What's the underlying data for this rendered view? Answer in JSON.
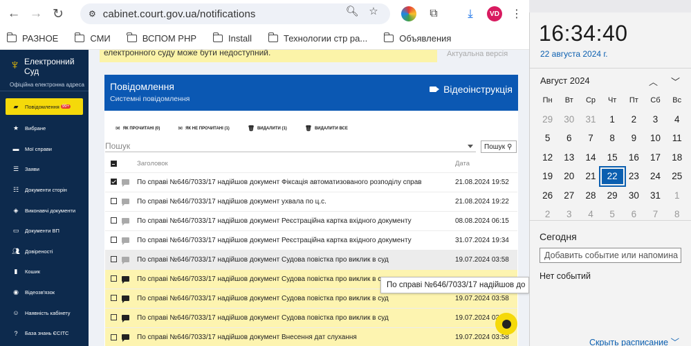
{
  "browser": {
    "url": "cabinet.court.gov.ua/notifications",
    "avatar_initials": "VD",
    "bookmarks": [
      "РАЗНОЕ",
      "СМИ",
      "ВСПОМ РНР",
      "Install",
      "Технологии стр ра...",
      "Объявления"
    ]
  },
  "sidebar": {
    "logo_line1": "Електронний",
    "logo_line2": "Суд",
    "logo_sub": "Офіційна електронна адреса",
    "items": [
      {
        "label": "Повідомлення",
        "badge": "99+",
        "icon": "bell-icon",
        "active": true
      },
      {
        "label": "Вибране",
        "icon": "star-icon"
      },
      {
        "label": "Мої справи",
        "icon": "folder-icon"
      },
      {
        "label": "Заяви",
        "icon": "list-icon"
      },
      {
        "label": "Документи сторін",
        "icon": "documents-icon"
      },
      {
        "label": "Виконавчі документи",
        "icon": "stack-icon"
      },
      {
        "label": "Документи ВП",
        "icon": "monitor-icon"
      },
      {
        "label": "Довіреності",
        "icon": "users-icon"
      },
      {
        "label": "Кошик",
        "icon": "trash-icon"
      },
      {
        "label": "Відеозв'язок",
        "icon": "video-icon"
      },
      {
        "label": "Наявність кабінету",
        "icon": "search-user-icon"
      },
      {
        "label": "База знань ЄСІТС",
        "icon": "help-icon"
      }
    ]
  },
  "main": {
    "warning_text": "електронного суду може бути недоступний.",
    "warning_right": "Актуальна версія",
    "banner_title": "Повідомлення",
    "banner_sub": "Системні повідомлення",
    "video_label": "Відеоінструкція",
    "toolbar": [
      "ЯК ПРОЧИТАНІ (0)",
      "ЯК НЕ ПРОЧИТАНІ (1)",
      "ВИДАЛИТИ (1)",
      "ВИДАЛИТИ ВСЕ"
    ],
    "filter_placeholder": "Пошук",
    "search_button": "Пошук",
    "col_title": "Заголовок",
    "col_date": "Дата",
    "rows": [
      {
        "title": "По справі №646/7033/17 надійшов документ Фіксація автоматизованого розподілу справ",
        "date": "21.08.2024 19:52",
        "checked": true,
        "unread": false
      },
      {
        "title": "По справі №646/7033/17 надійшов документ ухвала по ц.с.",
        "date": "21.08.2024 19:22",
        "checked": false,
        "unread": false
      },
      {
        "title": "По справі №646/7033/17 надійшов документ Реєстраційна картка вхідного документу",
        "date": "08.08.2024 06:15",
        "checked": false,
        "unread": false
      },
      {
        "title": "По справі №646/7033/17 надійшов документ Реєстраційна картка вхідного документу",
        "date": "31.07.2024 19:34",
        "checked": false,
        "unread": false
      },
      {
        "title": "По справі №646/7033/17 надійшов документ Судова повістка про виклик в суд",
        "date": "19.07.2024 03:58",
        "checked": false,
        "unread": false,
        "hover": true
      },
      {
        "title": "По справі №646/7033/17 надійшов документ Судова повістка про виклик в суд",
        "date": "",
        "checked": false,
        "unread": true
      },
      {
        "title": "По справі №646/7033/17 надійшов документ Судова повістка про виклик в суд",
        "date": "19.07.2024 03:58",
        "checked": false,
        "unread": true
      },
      {
        "title": "По справі №646/7033/17 надійшов документ Судова повістка про виклик в суд",
        "date": "19.07.2024 03:58",
        "checked": false,
        "unread": true
      },
      {
        "title": "По справі №646/7033/17 надійшов документ Внесення дат слухання",
        "date": "19.07.2024 03:58",
        "checked": false,
        "unread": true
      }
    ],
    "tooltip": "По справі №646/7033/17 надійшов до"
  },
  "calendar": {
    "time": "16:34:40",
    "date_long": "22 августа 2024 г.",
    "month_title": "Август 2024",
    "weekdays": [
      "Пн",
      "Вт",
      "Ср",
      "Чт",
      "Пт",
      "Сб",
      "Вс"
    ],
    "weeks": [
      [
        [
          "29",
          1
        ],
        [
          "30",
          1
        ],
        [
          "31",
          1
        ],
        [
          "1",
          0
        ],
        [
          "2",
          0
        ],
        [
          "3",
          0
        ],
        [
          "4",
          0
        ]
      ],
      [
        [
          "5",
          0
        ],
        [
          "6",
          0
        ],
        [
          "7",
          0
        ],
        [
          "8",
          0
        ],
        [
          "9",
          0
        ],
        [
          "10",
          0
        ],
        [
          "11",
          0
        ]
      ],
      [
        [
          "12",
          0
        ],
        [
          "13",
          0
        ],
        [
          "14",
          0
        ],
        [
          "15",
          0
        ],
        [
          "16",
          0
        ],
        [
          "17",
          0
        ],
        [
          "18",
          0
        ]
      ],
      [
        [
          "19",
          0
        ],
        [
          "20",
          0
        ],
        [
          "21",
          0
        ],
        [
          "22",
          2
        ],
        [
          "23",
          0
        ],
        [
          "24",
          0
        ],
        [
          "25",
          0
        ]
      ],
      [
        [
          "26",
          0
        ],
        [
          "27",
          0
        ],
        [
          "28",
          0
        ],
        [
          "29",
          0
        ],
        [
          "30",
          0
        ],
        [
          "31",
          0
        ],
        [
          "1",
          1
        ]
      ],
      [
        [
          "2",
          1
        ],
        [
          "3",
          1
        ],
        [
          "4",
          1
        ],
        [
          "5",
          1
        ],
        [
          "6",
          1
        ],
        [
          "7",
          1
        ],
        [
          "8",
          1
        ]
      ]
    ],
    "today_label": "Сегодня",
    "event_placeholder": "Добавить событие или напомина",
    "no_events": "Нет событий",
    "hide_schedule": "Скрыть расписание"
  }
}
